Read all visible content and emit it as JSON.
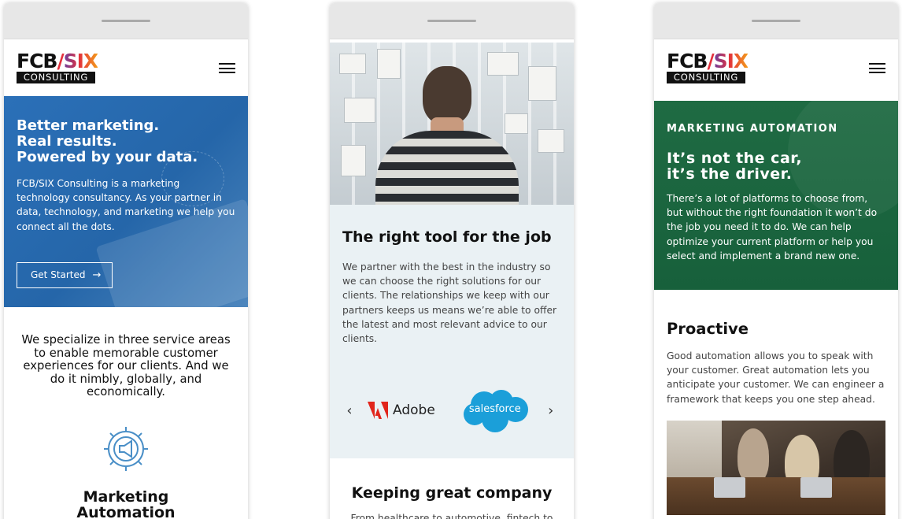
{
  "brand": {
    "logo_top_fcb": "FCB",
    "logo_top_slash": "/",
    "logo_top_six": "SIX",
    "logo_bottom": "CONSULTING",
    "colors": {
      "blue_hero": "#2b70b8",
      "green_hero": "#1f6b43",
      "light_section": "#eaf1f4",
      "accent_red": "#e3303c"
    }
  },
  "phone1": {
    "hero": {
      "headline_lines": [
        "Better marketing.",
        "Real results.",
        "Powered by your data."
      ],
      "body": "FCB/SIX Consulting is a marketing technology consultancy. As your partner in data, technology, and marketing we help you connect all the dots.",
      "cta_label": "Get Started",
      "cta_icon": "arrow-right-icon"
    },
    "intro": "We specialize in three service areas to enable memorable customer experiences for our clients. And we do it nimbly, globally, and economically.",
    "service": {
      "icon": "megaphone-gear-icon",
      "title_lines": [
        "Marketing",
        "Automation"
      ]
    }
  },
  "phone2": {
    "tool": {
      "title": "The right tool for the job",
      "body": "We partner with the best in the industry so we can choose the right solutions for our clients. The relationships we keep with our partners keeps us means we’re able to offer the latest and most relevant advice to our clients."
    },
    "carousel": {
      "prev_icon": "chevron-left-icon",
      "next_icon": "chevron-right-icon",
      "logos": [
        {
          "name": "Adobe"
        },
        {
          "name": "salesforce"
        }
      ]
    },
    "company": {
      "title": "Keeping great company",
      "body_partial": "From healthcare to automotive, fintech to"
    }
  },
  "phone3": {
    "hero": {
      "eyebrow": "MARKETING AUTOMATION",
      "headline_lines": [
        "It’s not the car,",
        "it’s the driver."
      ],
      "body": "There’s a lot of platforms to choose from, but without the right foundation it won’t do the job you need it to do. We can help optimize your current platform or help you select and implement a brand new one."
    },
    "proactive": {
      "title": "Proactive",
      "body": "Good automation allows you to speak with your customer. Great automation lets you anticipate your customer. We can engineer a framework that keeps you one step ahead."
    }
  }
}
